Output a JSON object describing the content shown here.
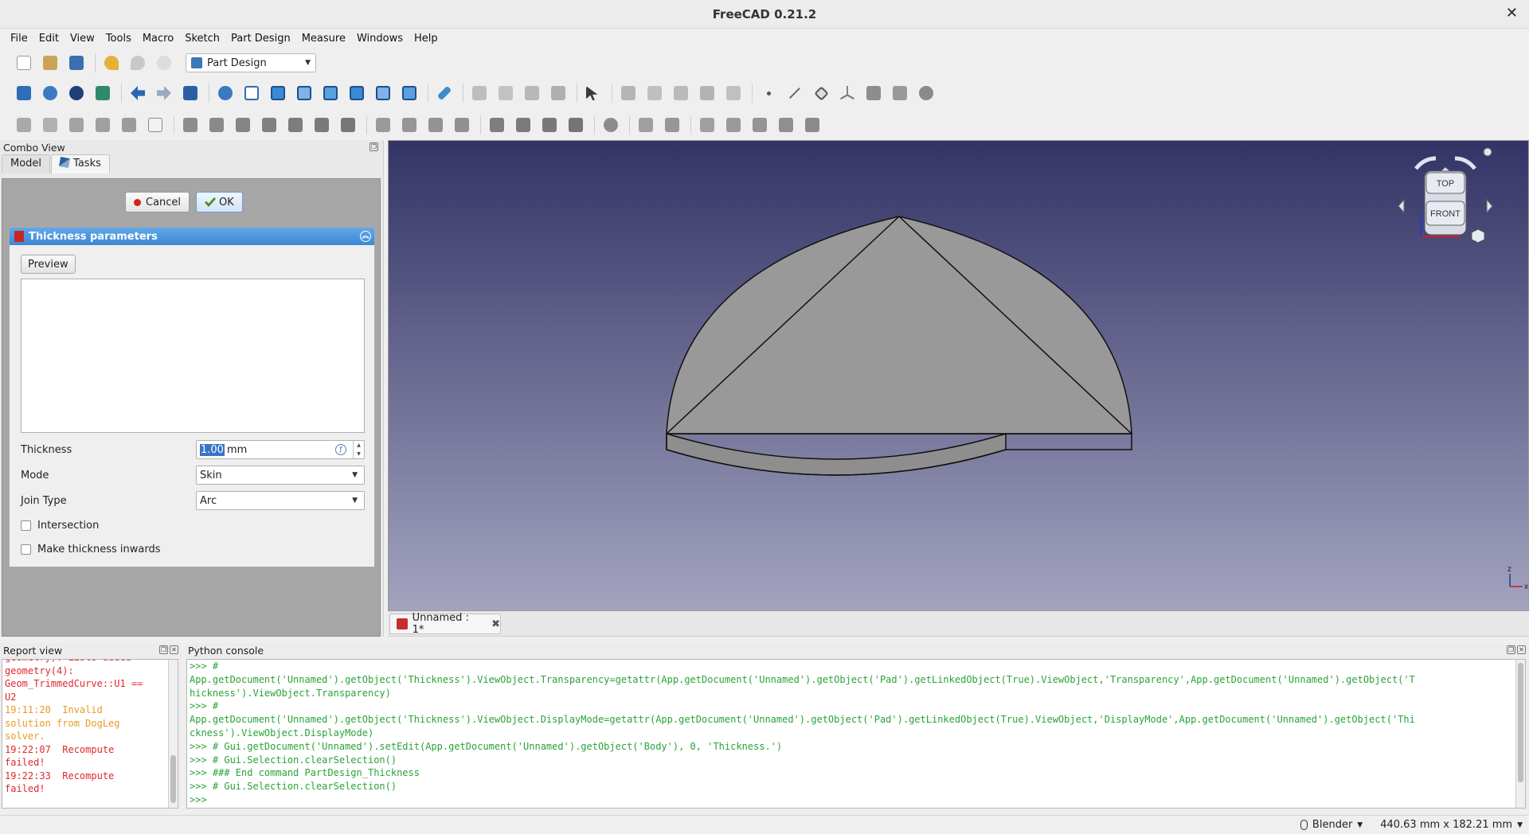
{
  "window": {
    "title": "FreeCAD 0.21.2",
    "close_glyph": "✕"
  },
  "menu": [
    "File",
    "Edit",
    "View",
    "Tools",
    "Macro",
    "Sketch",
    "Part Design",
    "Measure",
    "Windows",
    "Help"
  ],
  "workbench": {
    "selected": "Part Design"
  },
  "combo_view": {
    "title": "Combo View",
    "tabs": [
      {
        "label": "Model"
      },
      {
        "label": "Tasks"
      }
    ],
    "cancel_label": "Cancel",
    "ok_label": "OK",
    "panel": {
      "title": "Thickness parameters",
      "preview_label": "Preview",
      "thickness_label": "Thickness",
      "thickness_value": "1.00",
      "thickness_unit": "mm",
      "mode_label": "Mode",
      "mode_value": "Skin",
      "join_label": "Join Type",
      "join_value": "Arc",
      "intersection_label": "Intersection",
      "inwards_label": "Make thickness inwards"
    }
  },
  "navcube": {
    "top": "TOP",
    "front": "FRONT"
  },
  "axes": {
    "z": "z",
    "x": "x"
  },
  "doc_tab": {
    "label": "Unnamed : 1*"
  },
  "report": {
    "title": "Report view",
    "lines": [
      {
        "t": "geometry). Lists added",
        "c": "err"
      },
      {
        "t": "geometry(4):",
        "c": "err"
      },
      {
        "t": "Geom_TrimmedCurve::U1 ==",
        "c": "err"
      },
      {
        "t": "U2",
        "c": "err"
      },
      {
        "t": "19:11:20  Invalid",
        "c": "warn"
      },
      {
        "t": "solution from DogLeg",
        "c": "warn"
      },
      {
        "t": "solver.",
        "c": "warn"
      },
      {
        "t": "19:22:07  Recompute",
        "c": "err"
      },
      {
        "t": "failed!",
        "c": "err"
      },
      {
        "t": "19:22:33  Recompute",
        "c": "err"
      },
      {
        "t": "failed!",
        "c": "err"
      }
    ]
  },
  "console": {
    "title": "Python console",
    "lines": [
      ">>> #",
      "App.getDocument('Unnamed').getObject('Thickness').ViewObject.Transparency=getattr(App.getDocument('Unnamed').getObject('Pad').getLinkedObject(True).ViewObject,'Transparency',App.getDocument('Unnamed').getObject('T",
      "hickness').ViewObject.Transparency)",
      ">>> #",
      "App.getDocument('Unnamed').getObject('Thickness').ViewObject.DisplayMode=getattr(App.getDocument('Unnamed').getObject('Pad').getLinkedObject(True).ViewObject,'DisplayMode',App.getDocument('Unnamed').getObject('Thi",
      "ckness').ViewObject.DisplayMode)",
      ">>> # Gui.getDocument('Unnamed').setEdit(App.getDocument('Unnamed').getObject('Body'), 0, 'Thickness.')",
      ">>> # Gui.Selection.clearSelection()",
      ">>> ### End command PartDesign_Thickness",
      ">>> # Gui.Selection.clearSelection()",
      ">>>"
    ]
  },
  "status": {
    "nav_style": "Blender",
    "dimensions": "440.63 mm x 182.21 mm"
  },
  "colors": {
    "viewport_top": "#333366",
    "viewport_bottom": "#a3a3bf",
    "solid_face": "#999999",
    "console_text": "#2aa338",
    "report_error": "#e0282d",
    "report_warning": "#e89a25"
  }
}
